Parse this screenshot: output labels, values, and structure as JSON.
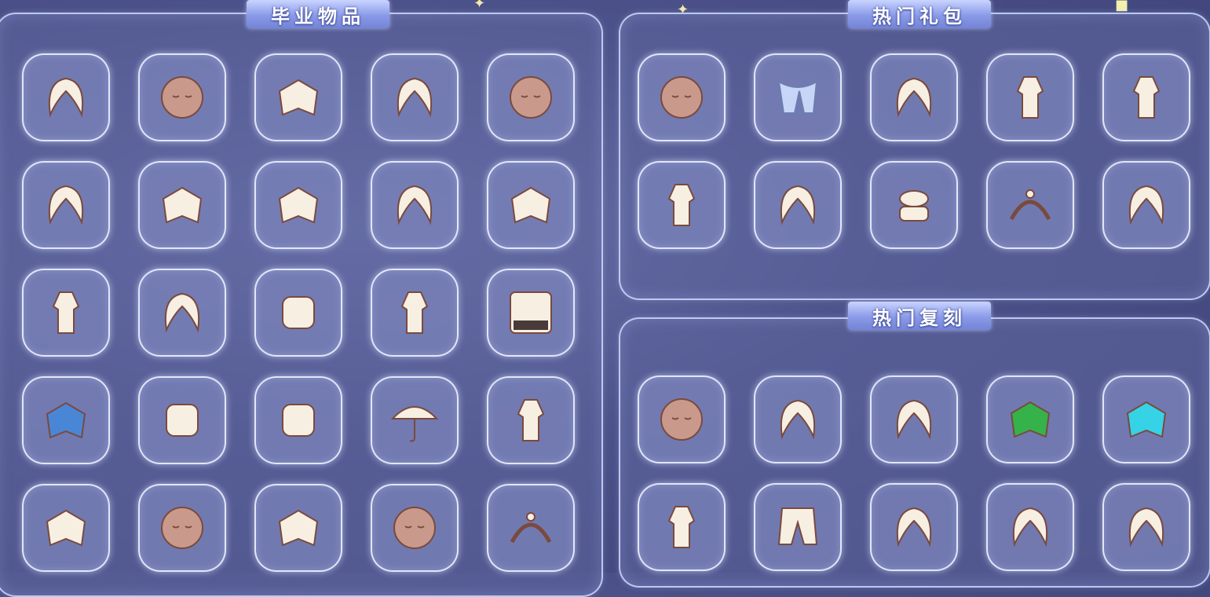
{
  "sections": {
    "graduation": {
      "title": "毕业物品"
    },
    "hot_packs": {
      "title": "热门礼包"
    },
    "hot_reruns": {
      "title": "热门复刻"
    }
  },
  "graduation_items": [
    "hair-icon",
    "mask-icon",
    "cape-icon",
    "hair-icon",
    "mask-icon",
    "hair-icon",
    "cape-icon",
    "cape-icon",
    "hair-icon",
    "cape-icon",
    "outfit-icon",
    "hair-icon",
    "prop-icon",
    "outfit-icon",
    "piano-icon",
    "cape-icon",
    "prop-icon",
    "prop-icon",
    "umbrella-icon",
    "outfit-icon",
    "cape-icon",
    "mask-icon",
    "cape-icon",
    "mask-icon",
    "headpiece-icon"
  ],
  "hot_pack_items": [
    "mask-icon",
    "scarf-icon",
    "hair-icon",
    "outfit-icon",
    "outfit-icon",
    "outfit-icon",
    "hair-icon",
    "hat-icon",
    "headpiece-icon",
    "hair-icon"
  ],
  "hot_rerun_items": [
    "mask-icon",
    "hair-icon",
    "hair-icon",
    "cape-icon",
    "cape-icon",
    "outfit-icon",
    "pants-icon",
    "hair-icon",
    "hair-icon",
    "hair-icon"
  ],
  "colors": {
    "background": "#4c528a",
    "panel_border": "#d2dcff",
    "item_cream": "#f7efe2",
    "item_outline": "#7a4a3e",
    "tab": "#8a9ae8"
  }
}
